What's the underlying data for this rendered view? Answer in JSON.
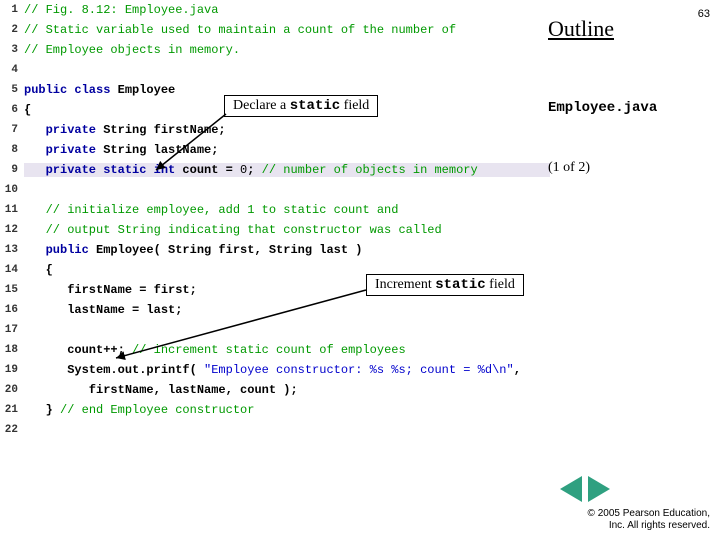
{
  "slide": {
    "page_number": "63",
    "outline": "Outline",
    "filename": "Employee.java",
    "part": "(1 of  2)",
    "copyright_line1": "© 2005 Pearson Education,",
    "copyright_line2": "Inc.  All rights reserved."
  },
  "callouts": {
    "declare_pre": "Declare a ",
    "declare_code": "static",
    "declare_post": " field",
    "increment_pre": "Increment ",
    "increment_code": "static",
    "increment_post": " field"
  },
  "code": {
    "l1": "// Fig. 8.12: Employee.java",
    "l2": "// Static variable used to maintain a count of the number of",
    "l3": "// Employee objects in memory.",
    "l4": "",
    "l5a": "public class",
    "l5b": " Employee",
    "l6": "{",
    "l7a": "   private",
    "l7b": " String firstName;",
    "l8a": "   private",
    "l8b": " String lastName;",
    "l9a": "   private static int",
    "l9b": " count = ",
    "l9c": "0",
    "l9d": ";",
    "l9e": " // number of objects in memory",
    "l10": "",
    "l11": "   // initialize employee, add 1 to static count and",
    "l12": "   // output String indicating that constructor was called",
    "l13a": "   public",
    "l13b": " Employee( String first, String last )",
    "l14": "   {",
    "l15": "      firstName = first;",
    "l16": "      lastName = last;",
    "l17": "",
    "l18a": "      count++;",
    "l18b": " // increment static count of employees",
    "l19a": "      System.out.printf( ",
    "l19b": "\"Employee constructor: %s %s; count = %d\\n\"",
    "l19c": ",",
    "l20": "         firstName, lastName, count );",
    "l21a": "   }",
    "l21b": " // end Employee constructor",
    "l22": ""
  }
}
